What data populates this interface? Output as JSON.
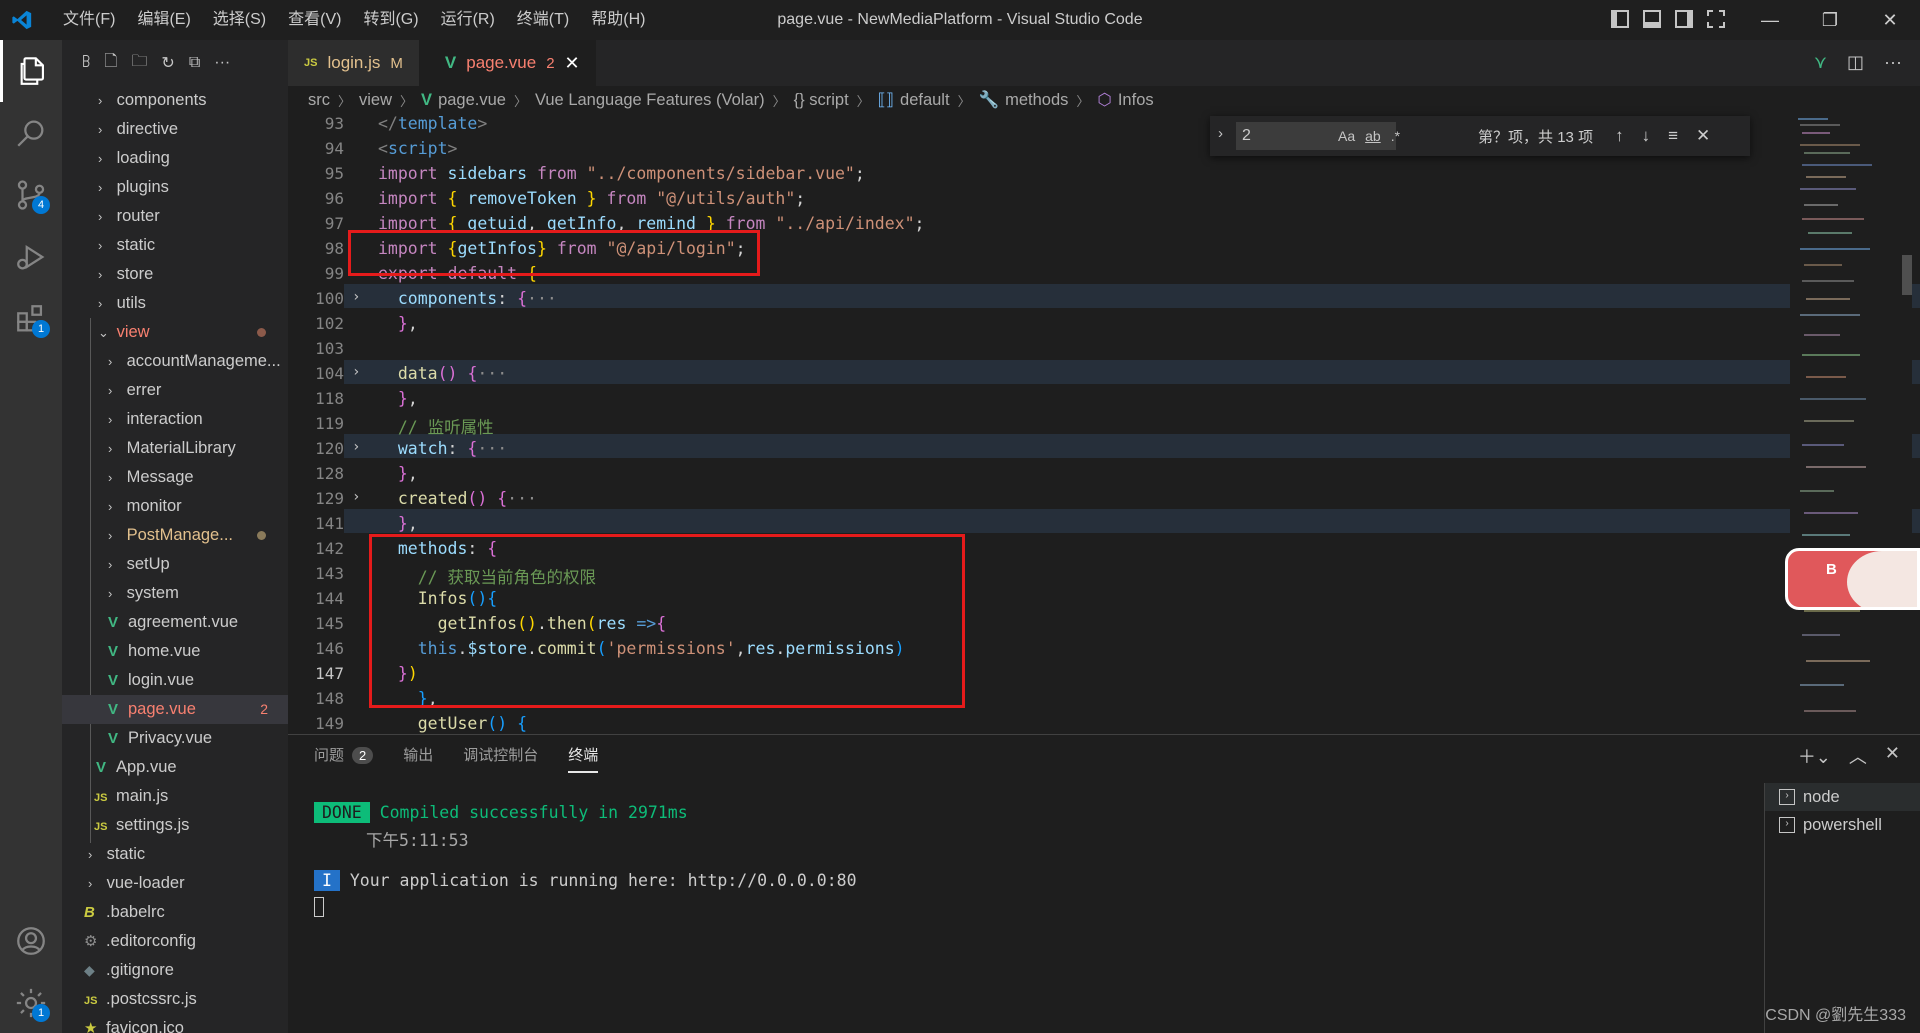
{
  "window": {
    "title": "page.vue - NewMediaPlatform - Visual Studio Code",
    "menu": [
      "文件(F)",
      "编辑(E)",
      "选择(S)",
      "查看(V)",
      "转到(G)",
      "运行(R)",
      "终端(T)",
      "帮助(H)"
    ]
  },
  "activity": {
    "scm_badge": "4",
    "ext_badge": "1",
    "settings_badge": "1"
  },
  "explorer": {
    "items": [
      {
        "label": "components",
        "kind": "folder",
        "depth": 1
      },
      {
        "label": "directive",
        "kind": "folder",
        "depth": 1
      },
      {
        "label": "loading",
        "kind": "folder",
        "depth": 1
      },
      {
        "label": "plugins",
        "kind": "folder",
        "depth": 1
      },
      {
        "label": "router",
        "kind": "folder",
        "depth": 1
      },
      {
        "label": "static",
        "kind": "folder",
        "depth": 1
      },
      {
        "label": "store",
        "kind": "folder",
        "depth": 1
      },
      {
        "label": "utils",
        "kind": "folder",
        "depth": 1
      },
      {
        "label": "view",
        "kind": "folder-open",
        "depth": 1
      },
      {
        "label": "accountManageme...",
        "kind": "folder",
        "depth": 2
      },
      {
        "label": "errer",
        "kind": "folder",
        "depth": 2
      },
      {
        "label": "interaction",
        "kind": "folder",
        "depth": 2
      },
      {
        "label": "MaterialLibrary",
        "kind": "folder",
        "depth": 2
      },
      {
        "label": "Message",
        "kind": "folder",
        "depth": 2
      },
      {
        "label": "monitor",
        "kind": "folder",
        "depth": 2
      },
      {
        "label": "PostManage...",
        "kind": "folder",
        "depth": 2
      },
      {
        "label": "setUp",
        "kind": "folder",
        "depth": 2
      },
      {
        "label": "system",
        "kind": "folder",
        "depth": 2
      },
      {
        "label": "agreement.vue",
        "kind": "vue",
        "depth": 2
      },
      {
        "label": "home.vue",
        "kind": "vue",
        "depth": 2
      },
      {
        "label": "login.vue",
        "kind": "vue",
        "depth": 2
      },
      {
        "label": "page.vue",
        "kind": "vue",
        "depth": 2
      },
      {
        "label": "Privacy.vue",
        "kind": "vue",
        "depth": 2
      },
      {
        "label": "App.vue",
        "kind": "vue",
        "depth": 1
      },
      {
        "label": "main.js",
        "kind": "js",
        "depth": 1
      },
      {
        "label": "settings.js",
        "kind": "js",
        "depth": 1
      },
      {
        "label": "static",
        "kind": "folder",
        "depth": 0
      },
      {
        "label": "vue-loader",
        "kind": "folder",
        "depth": 0
      },
      {
        "label": ".babelrc",
        "kind": "babel",
        "depth": 0
      },
      {
        "label": ".editorconfig",
        "kind": "gear",
        "depth": 0
      },
      {
        "label": ".gitignore",
        "kind": "git",
        "depth": 0
      },
      {
        "label": ".postcssrc.js",
        "kind": "js",
        "depth": 0
      },
      {
        "label": "favicon.ico",
        "kind": "star",
        "depth": 0
      }
    ],
    "page_vue_problems": "2"
  },
  "tabs": [
    {
      "label": "login.js",
      "indicator": "M",
      "icon": "JS"
    },
    {
      "label": "page.vue",
      "indicator": "2",
      "icon": "V"
    }
  ],
  "breadcrumb": [
    "src",
    "view",
    "page.vue",
    "Vue Language Features (Volar)",
    "{} script",
    "default",
    "methods",
    "Infos"
  ],
  "find": {
    "query": "2",
    "options": [
      "Aa",
      "ab",
      ".*"
    ],
    "result": "第？项，共 13 项"
  },
  "editor": {
    "line_numbers": [
      "93",
      "94",
      "95",
      "96",
      "97",
      "98",
      "99",
      "100",
      "102",
      "103",
      "104",
      "118",
      "119",
      "120",
      "128",
      "129",
      "141",
      "142",
      "143",
      "144",
      "145",
      "146",
      "147",
      "148",
      "149"
    ],
    "current_line": "147"
  },
  "panel": {
    "tabs": [
      "问题",
      "输出",
      "调试控制台",
      "终端"
    ],
    "problems_count": "2",
    "terminal": {
      "done_badge": "DONE",
      "done_text": "Compiled successfully in 2971ms",
      "time": "下午5:11:53",
      "info_badge": "I",
      "running_text": "Your application is running here: http://0.0.0.0:80"
    },
    "terminals": [
      "node",
      "powershell"
    ]
  },
  "watermark": "CSDN @劉先生333"
}
